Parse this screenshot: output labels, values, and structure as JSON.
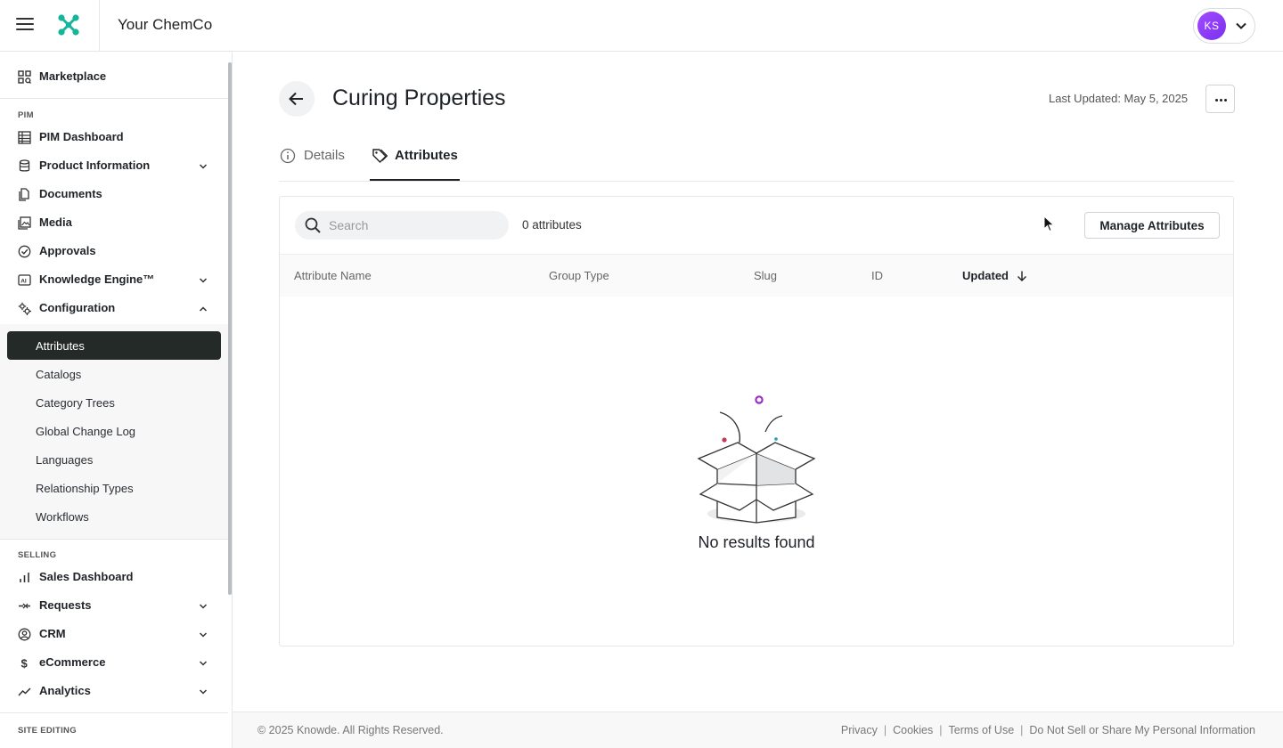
{
  "header": {
    "company_name": "Your ChemCo",
    "user_initials": "KS",
    "avatar_color": "#8f3cf7"
  },
  "sidebar": {
    "marketplace": "Marketplace",
    "pim_section": "PIM",
    "pim_items": [
      {
        "label": "PIM Dashboard",
        "icon": "grid-list-icon",
        "expandable": false
      },
      {
        "label": "Product Information",
        "icon": "database-icon",
        "expandable": true
      },
      {
        "label": "Documents",
        "icon": "documents-icon",
        "expandable": false
      },
      {
        "label": "Media",
        "icon": "media-icon",
        "expandable": false
      },
      {
        "label": "Approvals",
        "icon": "check-circle-icon",
        "expandable": false
      },
      {
        "label": "Knowledge Engine™",
        "icon": "ai-icon",
        "expandable": true
      },
      {
        "label": "Configuration",
        "icon": "config-icon",
        "expandable": true,
        "expanded": true
      }
    ],
    "config_subitems": [
      "Attributes",
      "Catalogs",
      "Category Trees",
      "Global Change Log",
      "Languages",
      "Relationship Types",
      "Workflows"
    ],
    "active_subitem": "Attributes",
    "selling_section": "SELLING",
    "selling_items": [
      {
        "label": "Sales Dashboard",
        "icon": "bar-chart-icon",
        "expandable": false
      },
      {
        "label": "Requests",
        "icon": "requests-icon",
        "expandable": true
      },
      {
        "label": "CRM",
        "icon": "user-circle-icon",
        "expandable": true
      },
      {
        "label": "eCommerce",
        "icon": "dollar-icon",
        "expandable": true
      },
      {
        "label": "Analytics",
        "icon": "trend-icon",
        "expandable": true
      }
    ],
    "site_editing_section": "SITE EDITING"
  },
  "page": {
    "title": "Curing Properties",
    "last_updated": "Last Updated: May 5, 2025",
    "tabs": [
      {
        "label": "Details",
        "active": false
      },
      {
        "label": "Attributes",
        "active": true
      }
    ]
  },
  "attributes_panel": {
    "search_placeholder": "Search",
    "count_label": "0 attributes",
    "manage_button": "Manage Attributes",
    "columns": [
      "Attribute Name",
      "Group Type",
      "Slug",
      "ID",
      "Updated"
    ],
    "sorted_column": "Updated",
    "sort_direction": "descending",
    "empty_message": "No results found"
  },
  "footer": {
    "copyright": "© 2025 Knowde. All Rights Reserved.",
    "links": [
      "Privacy",
      "Cookies",
      "Terms of Use",
      "Do Not Sell or Share My Personal Information"
    ]
  }
}
